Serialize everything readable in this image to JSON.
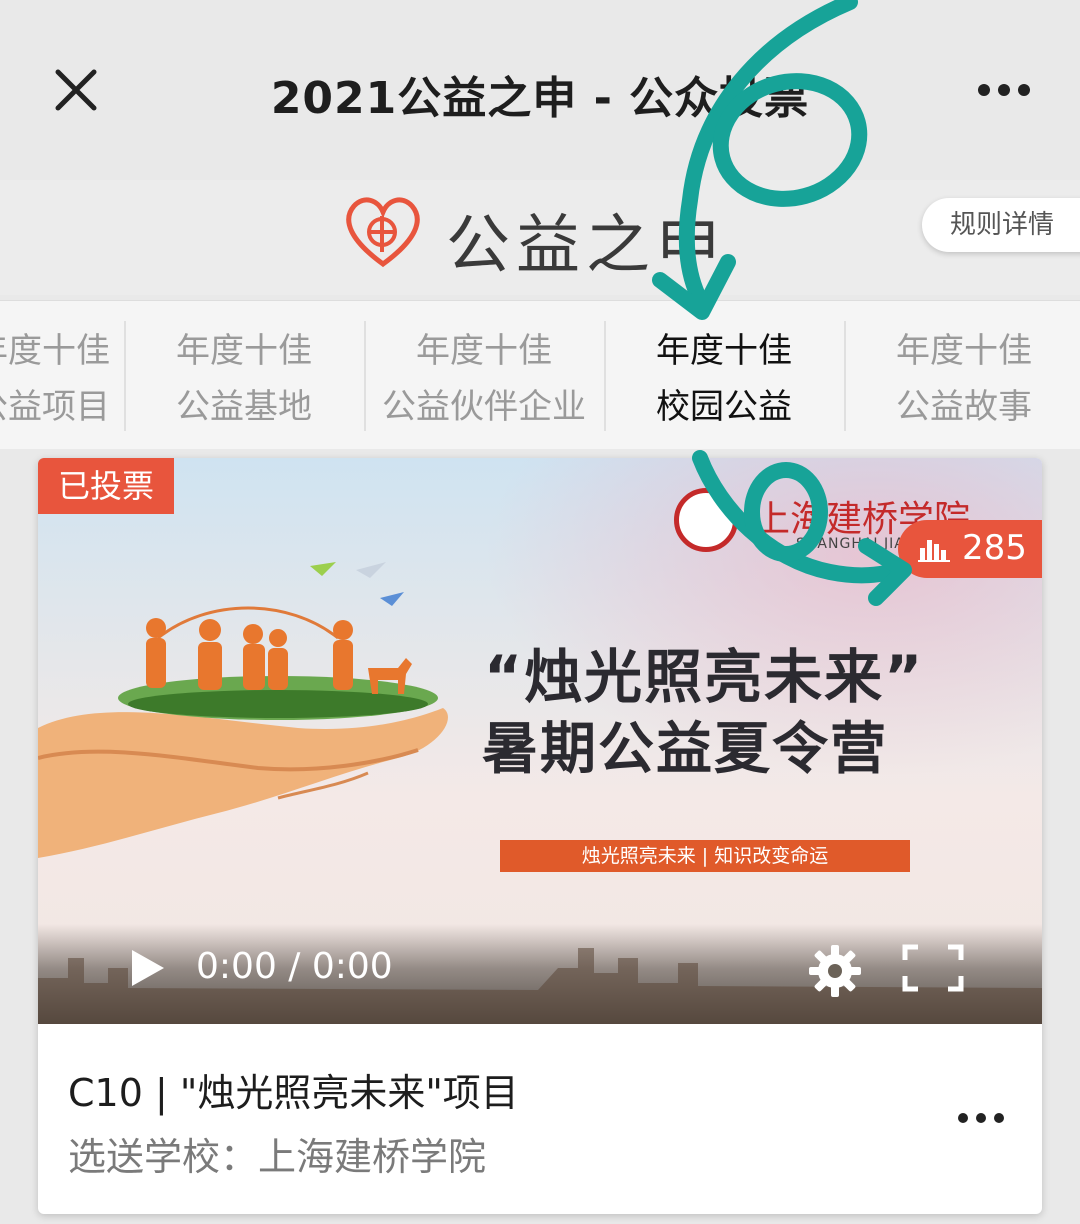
{
  "window": {
    "title": "2021公益之申 - 公众投票",
    "close_icon": "close-icon",
    "more_icon": "more-icon"
  },
  "brand": {
    "name": "公益之申",
    "rules_button": "规则详情",
    "logo_icon": "heart-logo-icon"
  },
  "tabs": [
    {
      "line1": "年度十佳",
      "line2": "公益项目",
      "active": false
    },
    {
      "line1": "年度十佳",
      "line2": "公益基地",
      "active": false
    },
    {
      "line1": "年度十佳",
      "line2": "公益伙伴企业",
      "active": false
    },
    {
      "line1": "年度十佳",
      "line2": "校园公益",
      "active": true
    },
    {
      "line1": "年度十佳",
      "line2": "公益故事",
      "active": false
    }
  ],
  "card": {
    "voted_badge": "已投票",
    "vote_count": "285",
    "school_name": "上海建桥学院",
    "school_pinyin": "SHANGHAI JIAN QIAO",
    "headline_line1": "“烛光照亮未来”",
    "headline_line2": "暑期公益夏令营",
    "slogan": "烛光照亮未来 | 知识改变命运",
    "player": {
      "time": "0:00 / 0:00",
      "icons": [
        "play-icon",
        "gear-icon",
        "fullscreen-icon"
      ]
    },
    "title": "C10 | \"烛光照亮未来\"项目",
    "subtitle": "选送学校：上海建桥学院"
  },
  "colors": {
    "accent_red": "#e8553d",
    "annotation_teal": "#17a398",
    "background": "#e9e9e9"
  }
}
